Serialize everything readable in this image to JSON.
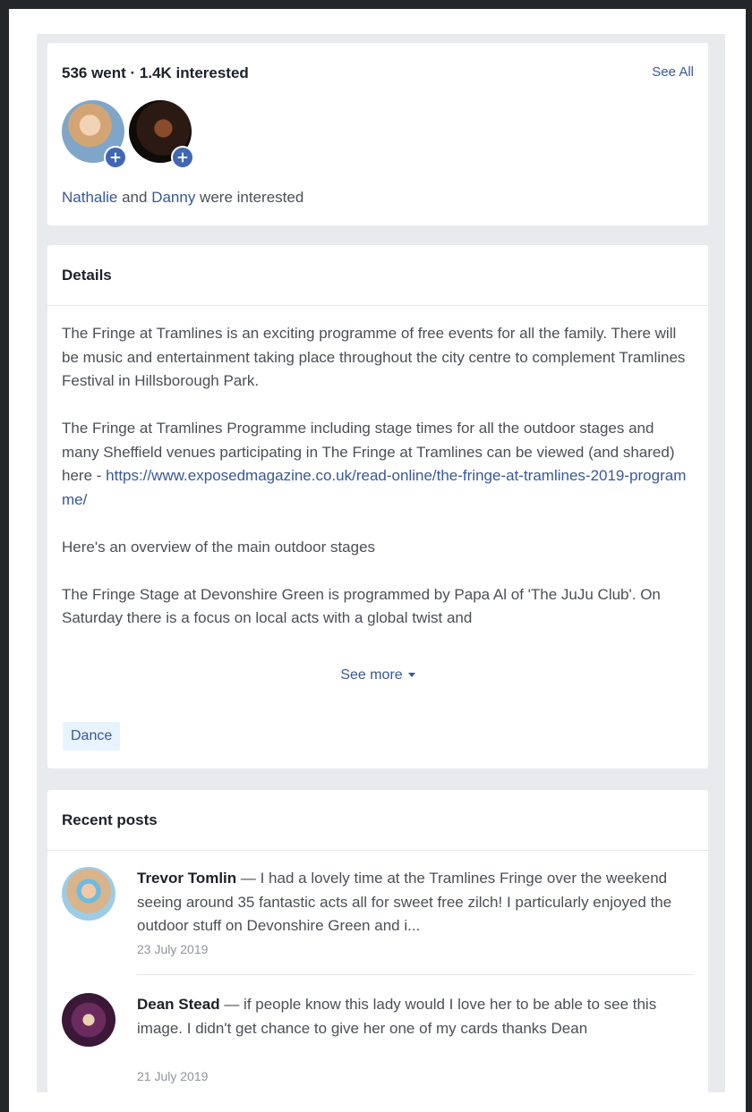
{
  "going": {
    "summary": "536 went · 1.4K interested",
    "see_all": "See All",
    "friend1": "Nathalie",
    "and_text": " and ",
    "friend2": "Danny",
    "suffix": " were interested"
  },
  "details": {
    "heading": "Details",
    "paragraph1": "The Fringe at Tramlines is an exciting programme of free events for all the family.  There will be music and entertainment taking place throughout the city centre to complement Tramlines Festival in Hillsborough Park.",
    "paragraph2": "The Fringe at Tramlines Programme including stage times for all the outdoor stages and many Sheffield venues participating in The Fringe at Tramlines can be viewed (and shared) here - ",
    "link": "https://www.exposedmagazine.co.uk/read-online/the-fringe-at-tramlines-2019-programme/",
    "paragraph3": "Here's an overview of the main outdoor stages",
    "paragraph4": "The Fringe Stage at Devonshire Green is programmed by Papa Al of  'The JuJu Club'. On Saturday there is a focus on local acts with a global twist and",
    "see_more": "See more",
    "tag": "Dance"
  },
  "recent_posts": {
    "heading": "Recent posts",
    "posts": [
      {
        "author": "Trevor Tomlin",
        "text": " — I had a lovely time at the Tramlines Fringe over the weekend seeing around 35 fantastic acts all for sweet free zilch! I particularly enjoyed the outdoor stuff on Devonshire Green and i...",
        "date": "23 July 2019"
      },
      {
        "author": "Dean Stead",
        "text": " — if people know this lady would I love her to be able to see this image. I didn't get chance to give her one of my cards thanks Dean",
        "date": "21 July 2019"
      }
    ]
  },
  "colors": {
    "link": "#385898",
    "badge": "#4267b2",
    "tag_bg": "#e7f3ff"
  }
}
